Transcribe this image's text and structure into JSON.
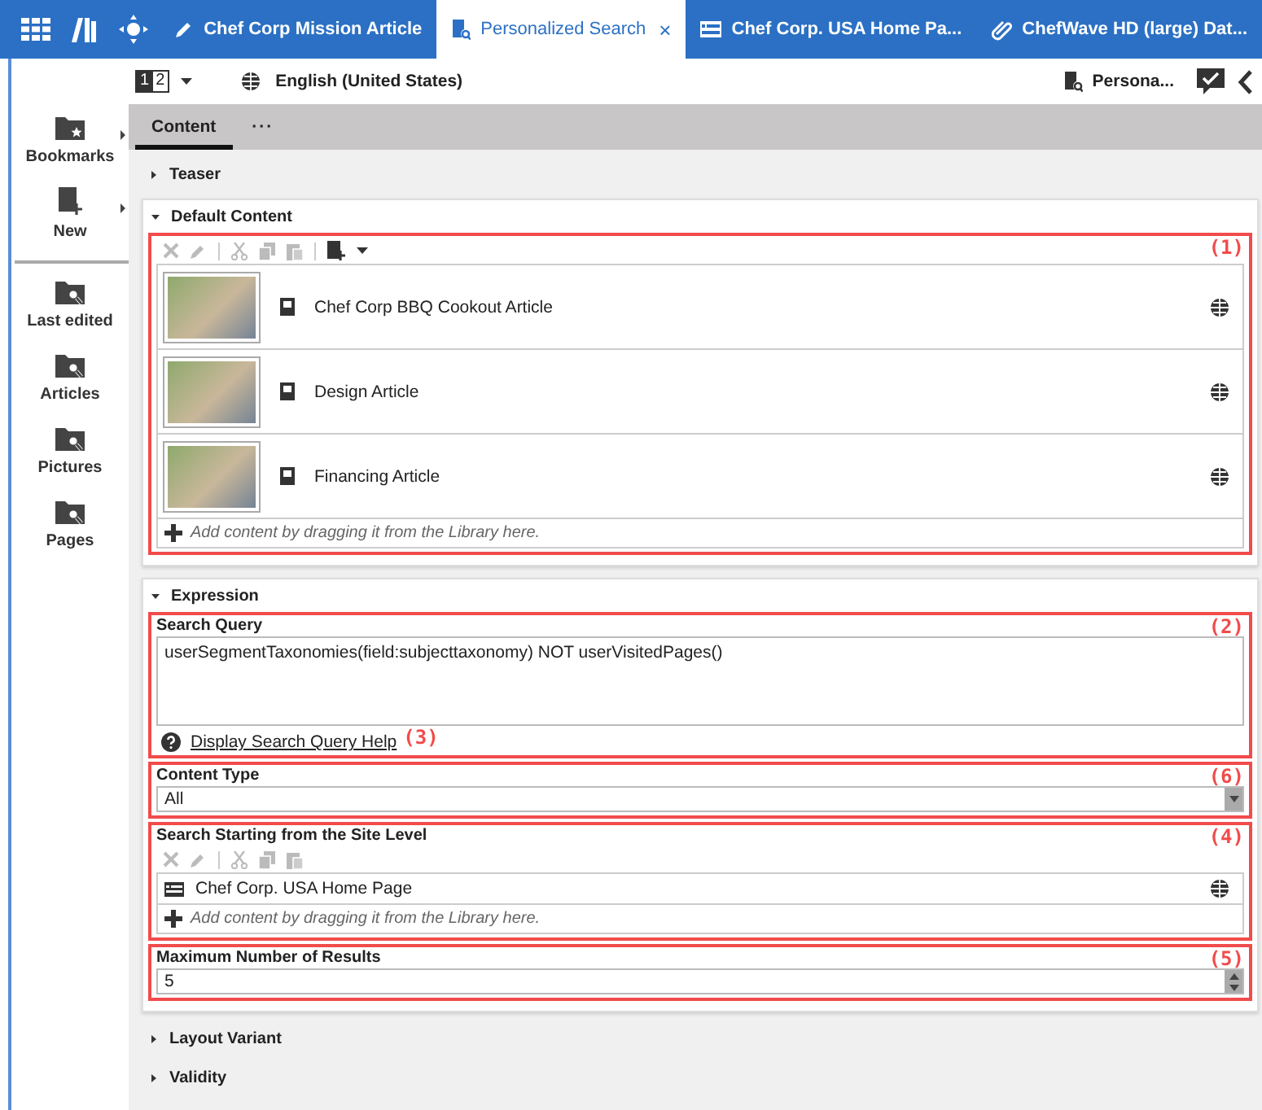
{
  "top_tabs": [
    {
      "label": "Chef Corp Mission Article",
      "selected": false
    },
    {
      "label": "Personalized Search",
      "selected": true,
      "close": "×"
    },
    {
      "label": "Chef Corp. USA Home Pa...",
      "selected": false
    },
    {
      "label": "ChefWave HD (large) Dat...",
      "selected": false
    }
  ],
  "subbar": {
    "view_switch": [
      {
        "label": "1",
        "selected": true
      },
      {
        "label": "2",
        "selected": false
      }
    ],
    "locale": "English (United States)",
    "document": "Persona..."
  },
  "sidebar": {
    "primary": [
      {
        "label": "Bookmarks",
        "submenu": true
      },
      {
        "label": "New",
        "submenu": true
      }
    ],
    "searches": [
      {
        "label": "Last edited"
      },
      {
        "label": "Articles"
      },
      {
        "label": "Pictures"
      },
      {
        "label": "Pages"
      }
    ]
  },
  "form_tabs": [
    {
      "label": "Content",
      "selected": true
    }
  ],
  "form_more": "···",
  "sections": [
    {
      "kind": "plain",
      "title": "Teaser",
      "expanded": false
    },
    {
      "kind": "default_content",
      "title": "Default Content",
      "expanded": true,
      "annotation": "(1)",
      "items": [
        {
          "title": "Chef Corp BBQ Cookout Article"
        },
        {
          "title": "Design Article"
        },
        {
          "title": "Financing Article"
        }
      ],
      "drop_hint": "Add content by dragging it from the Library here."
    },
    {
      "kind": "expression",
      "title": "Expression",
      "expanded": true,
      "fields": [
        {
          "kind": "query",
          "label": "Search Query",
          "value": "userSegmentTaxonomies(field:subjecttaxonomy) NOT userVisitedPages()",
          "help_link": "Display Search Query Help",
          "annotation": "(2)",
          "help_annotation": "(3)"
        },
        {
          "kind": "combo",
          "label": "Content Type",
          "value": "All",
          "annotation": "(6)"
        },
        {
          "kind": "linklist",
          "label": "Search Starting from the Site Level",
          "items": [
            {
              "title": "Chef Corp. USA Home Page"
            }
          ],
          "drop_hint": "Add content by dragging it from the Library here.",
          "annotation": "(4)"
        },
        {
          "kind": "spinner",
          "label": "Maximum Number of Results",
          "value": "5",
          "annotation": "(5)"
        }
      ]
    },
    {
      "kind": "plain",
      "title": "Layout Variant",
      "expanded": false
    },
    {
      "kind": "plain",
      "title": "Validity",
      "expanded": false
    }
  ]
}
